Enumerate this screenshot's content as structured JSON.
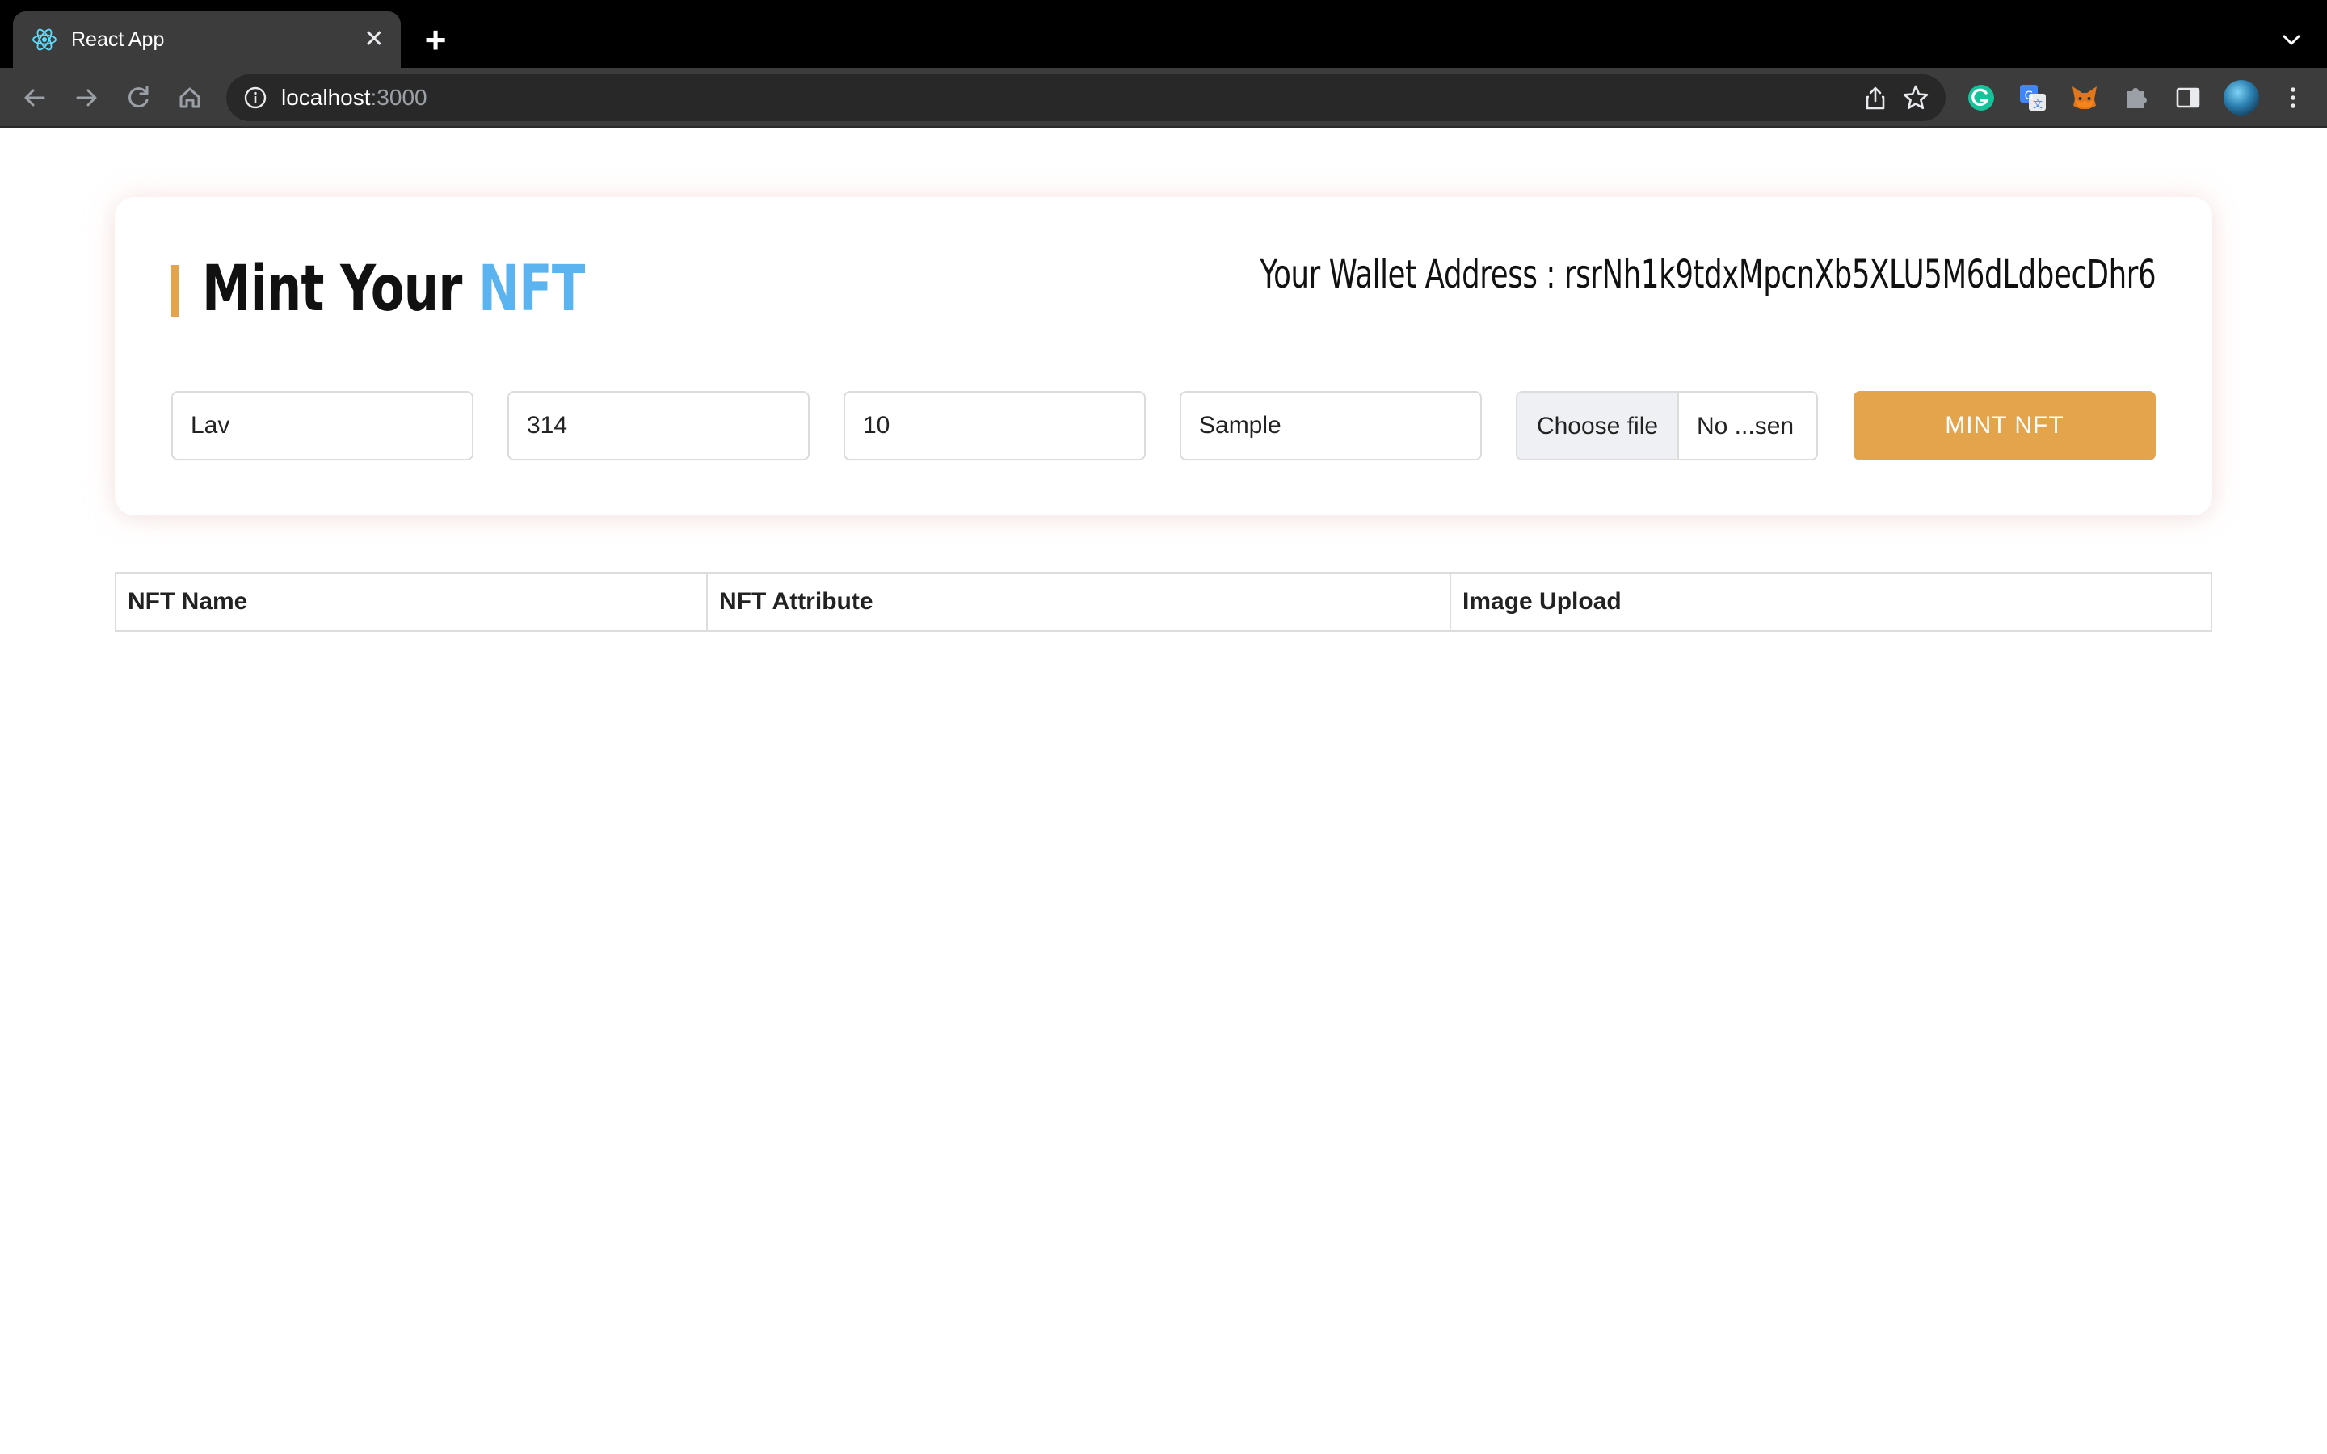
{
  "browser": {
    "tab_title": "React App",
    "url_host": "localhost",
    "url_port": ":3000"
  },
  "page": {
    "title_main": "Mint Your ",
    "title_accent": "NFT",
    "wallet_label": "Your Wallet Address : ",
    "wallet_address": "rsrNh1k9tdxMpcnXb5XLU5M6dLdbecDhr6",
    "form": {
      "name_value": "Lav",
      "number_value": "314",
      "quantity_value": "10",
      "attribute_value": "Sample",
      "file_button_label": "Choose file",
      "file_status": "No ...sen",
      "mint_button_label": "MINT NFT"
    },
    "table": {
      "headers": [
        "NFT Name",
        "NFT Attribute",
        "Image Upload"
      ]
    }
  },
  "colors": {
    "accent_orange": "#e3a44c",
    "accent_blue": "#5bb4f0"
  }
}
